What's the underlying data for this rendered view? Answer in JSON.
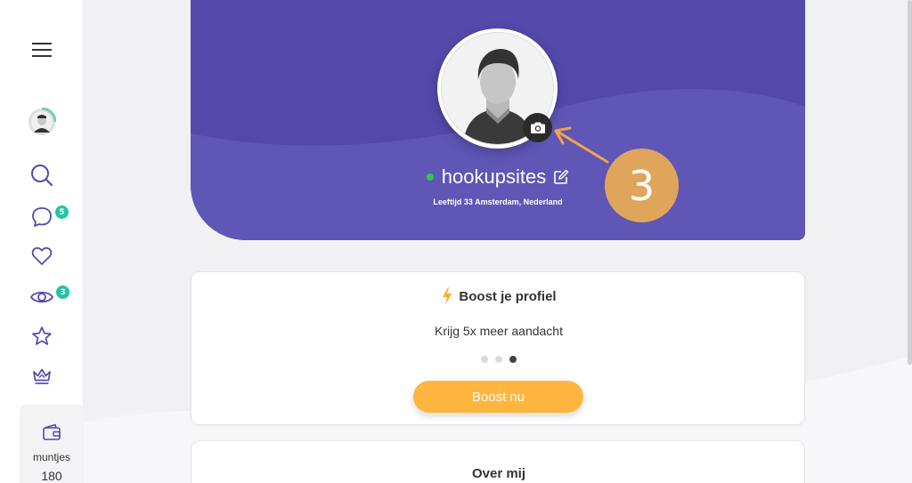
{
  "sidebar": {
    "items": [
      {
        "icon": "menu-icon"
      },
      {
        "icon": "user-avatar-icon"
      },
      {
        "icon": "search-icon"
      },
      {
        "icon": "chat-icon",
        "badge": "5"
      },
      {
        "icon": "heart-icon"
      },
      {
        "icon": "eye-icon",
        "badge": "3"
      },
      {
        "icon": "star-icon"
      },
      {
        "icon": "crown-icon"
      }
    ],
    "wallet": {
      "icon": "wallet-icon",
      "label": "muntjes",
      "value": "180"
    }
  },
  "profile": {
    "username": "hookupsites",
    "info_line": "Leeftijd 33 Amsterdam, Nederland",
    "online": true,
    "accent_color": "#5449ab"
  },
  "annotation": {
    "number": "3",
    "color": "#dfa55a"
  },
  "boost": {
    "title": "Boost je profiel",
    "subtitle": "Krijg 5x meer aandacht",
    "button_label": "Boost nu",
    "slides_total": 3,
    "slide_active": 3,
    "button_color": "#ffb53e"
  },
  "about": {
    "title": "Over mij"
  },
  "badge_color": "#25c3a2"
}
